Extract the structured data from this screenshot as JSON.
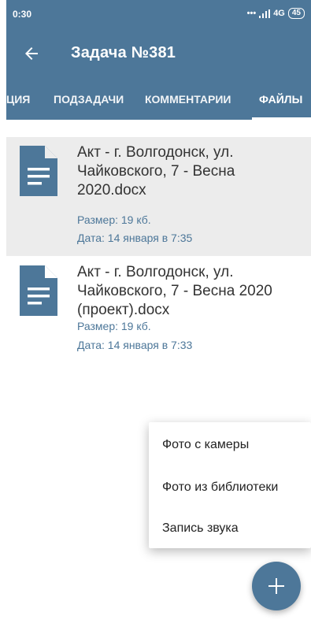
{
  "status_bar": {
    "time": "0:30",
    "network": "4G",
    "battery": "45"
  },
  "app_bar": {
    "title": "Задача №381"
  },
  "tabs": [
    {
      "label": "ЦИЯ"
    },
    {
      "label": "ПОДЗАДАЧИ"
    },
    {
      "label": "КОММЕНТАРИИ"
    },
    {
      "label": "ФАЙЛЫ",
      "active": true
    }
  ],
  "files": [
    {
      "name": "Акт - г. Волгодонск, ул. Чайковского, 7 - Весна 2020.docx",
      "size": "Размер: 19 кб.",
      "date": "Дата: 14 января в 7:35"
    },
    {
      "name": "Акт - г. Волгодонск, ул. Чайковского, 7 - Весна 2020 (проект).docx",
      "size": "Размер: 19 кб.",
      "date": "Дата: 14 января в 7:33"
    }
  ],
  "popup_menu": [
    {
      "label": "Фото с камеры"
    },
    {
      "label": "Фото из библиотеки"
    },
    {
      "label": "Запись звука"
    }
  ],
  "colors": {
    "primary": "#4d7799",
    "selected_row": "#ececec",
    "meta_text": "#4d7799"
  },
  "icons": {
    "back": "arrow-left-icon",
    "file": "document-icon",
    "fab": "plus-icon"
  }
}
